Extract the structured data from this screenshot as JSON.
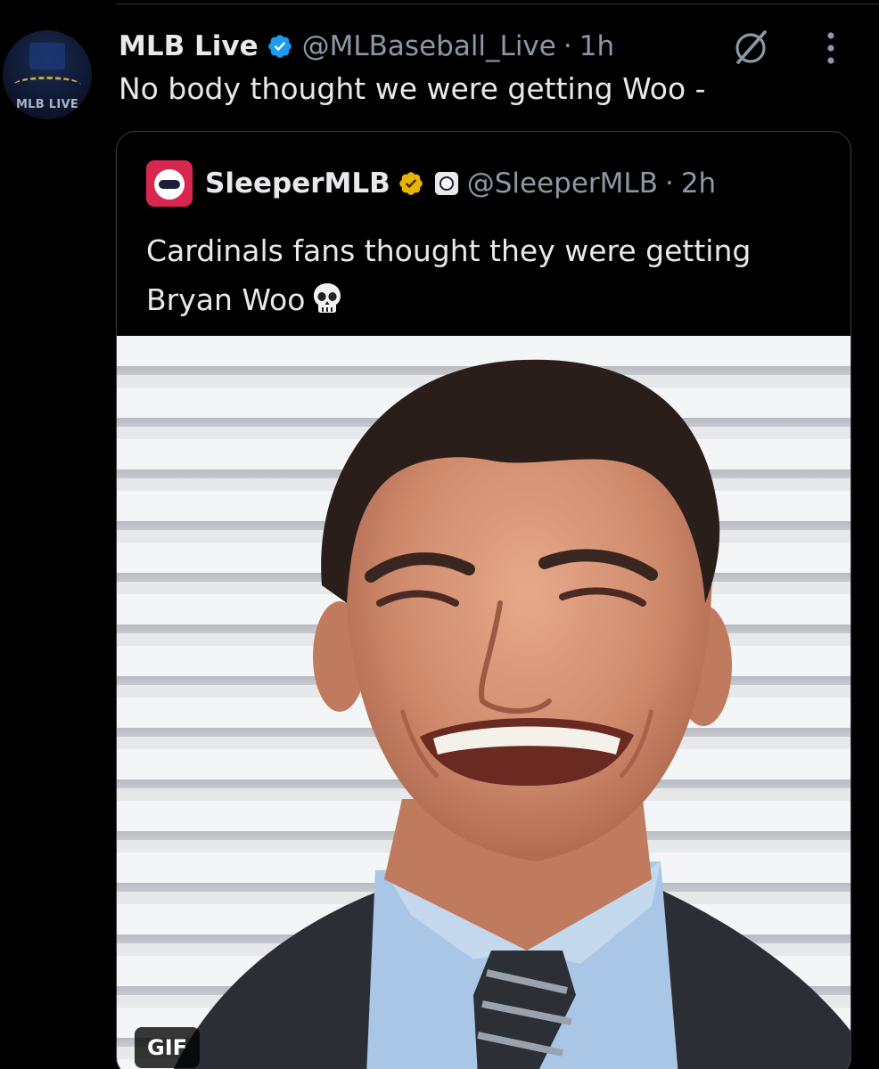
{
  "tweet": {
    "avatar_label": "MLB LIVE",
    "author_name": "MLB Live",
    "handle": "@MLBaseball_Live",
    "separator": "·",
    "time": "1h",
    "text": "No body thought we were getting Woo -"
  },
  "quote": {
    "author_name": "SleeperMLB",
    "handle": "@SleeperMLB",
    "separator": "·",
    "time": "2h",
    "text": "Cardinals fans thought they were getting Bryan Woo",
    "text_emoji": "skull-emoji",
    "media": {
      "type": "gif",
      "badge": "GIF",
      "description_icon": "grimacing-man-in-suit"
    }
  },
  "colors": {
    "background": "#000000",
    "text_primary": "#e7e9ea",
    "text_secondary": "#8b98a5",
    "verified_blue": "#1d9bf0",
    "verified_gold": "#e8b400",
    "border": "#3a3f44",
    "sleeper_red": "#d8264f"
  },
  "icons": {
    "verified": "verified-blue-icon",
    "gold_verified": "verified-gold-icon",
    "grok": "grok-icon",
    "more": "more-options-icon"
  }
}
